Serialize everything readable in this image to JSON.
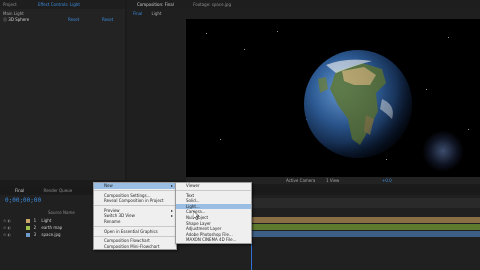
{
  "project_panel": {
    "tab_label": "Project",
    "effect_controls_tab": "Effect Controls: Light",
    "header_label": "Main Light",
    "row_label": "Ⓘ 3D Sphere",
    "row_value_1": "Reset",
    "row_value_2": "Reset"
  },
  "composition_panel": {
    "tab_label": "Composition: Final",
    "footage_tab": "Footage: space.jpg",
    "sub_tabs": [
      "Final",
      "Light"
    ],
    "active_camera": "Active Camera",
    "view_count": "1 View",
    "exposure": "+0.0"
  },
  "timeline": {
    "tab_label": "Final",
    "render_queue_tab": "Render Queue",
    "timecode": "0;00;00;00",
    "source_name_header": "Source Name",
    "layers": [
      {
        "num": "1",
        "name": "Light",
        "color": "#c9a76a"
      },
      {
        "num": "2",
        "name": "earth map",
        "color": "#9ec24a"
      },
      {
        "num": "3",
        "name": "space.jpg",
        "color": "#6e9ac9"
      }
    ]
  },
  "context_menu": {
    "items": [
      "New",
      "Composition Settings...",
      "Reveal Composition in Project",
      "Preview",
      "Switch 3D View",
      "Rename",
      "Open in Essential Graphics",
      "Composition Flowchart",
      "Composition Mini-Flowchart"
    ]
  },
  "submenu": {
    "items": [
      "Viewer",
      "Text",
      "Solid...",
      "Light...",
      "Camera...",
      "Null Object",
      "Shape Layer",
      "Adjustment Layer",
      "Adobe Photoshop File...",
      "MAXON CINEMA 4D File..."
    ]
  },
  "colors": {
    "menu_highlight": "#99bde3",
    "accent": "#3d8ee0",
    "playhead": "#2f6fd6"
  }
}
